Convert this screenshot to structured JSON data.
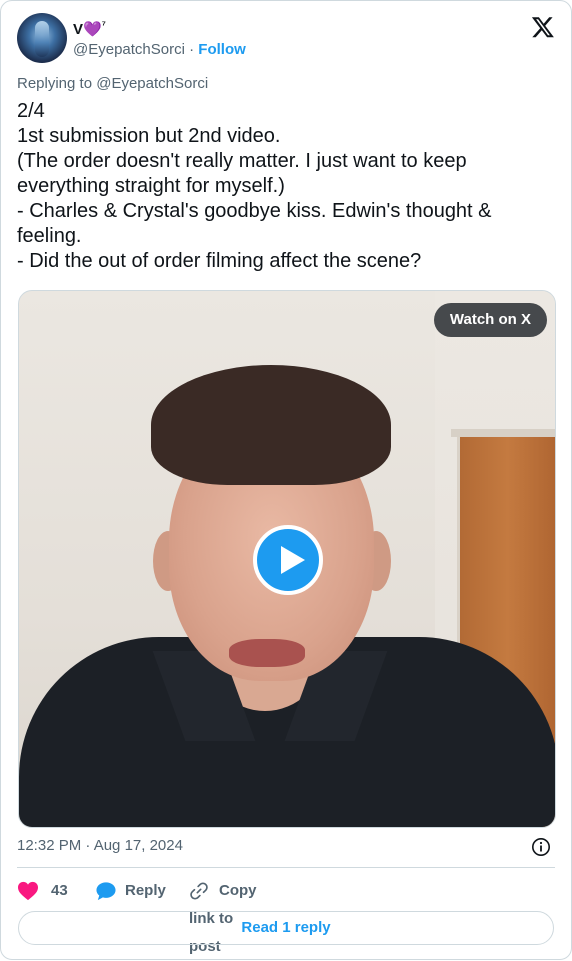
{
  "author": {
    "display_name": "V",
    "name_emoji": "💜",
    "name_suffix": "⁷",
    "handle": "@EyepatchSorci",
    "separator": "·",
    "follow_label": "Follow"
  },
  "replying_to": "Replying to @EyepatchSorci",
  "tweet_text": "2/4\n1st submission but 2nd video.\n(The order doesn't really matter. I just want to keep everything straight for myself.)\n- Charles & Crystal's goodbye kiss. Edwin's thought & feeling.\n- Did the out of order filming affect the scene?",
  "media": {
    "watch_label": "Watch on X",
    "play_icon": "play-icon"
  },
  "timestamp": "12:32 PM · Aug 17, 2024",
  "actions": {
    "like_count": "43",
    "reply_label": "Reply",
    "copy_label": "Copy link to post"
  },
  "read_replies_label": "Read 1 reply",
  "colors": {
    "accent": "#1d9bf0",
    "like": "#f91880",
    "muted": "#536471",
    "border": "#cfd9de"
  }
}
